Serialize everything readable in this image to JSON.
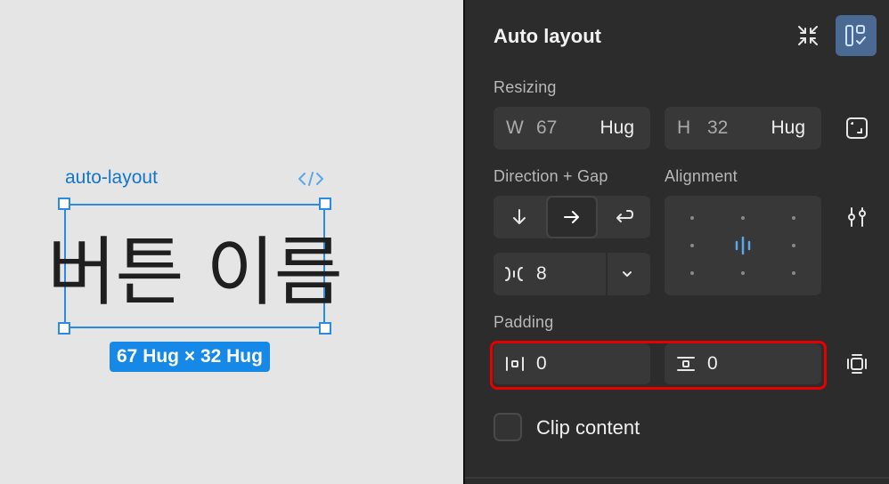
{
  "canvas": {
    "frame_label": "auto-layout",
    "frame_text": "버튼 이름",
    "size_badge": "67 Hug × 32 Hug"
  },
  "panel": {
    "title": "Auto layout",
    "resizing": {
      "label": "Resizing",
      "width": {
        "prefix": "W",
        "value": "67",
        "mode": "Hug"
      },
      "height": {
        "prefix": "H",
        "value": "32",
        "mode": "Hug"
      }
    },
    "direction": {
      "label": "Direction + Gap",
      "selected": "horizontal",
      "gap": "8"
    },
    "alignment": {
      "label": "Alignment",
      "selected": "center"
    },
    "padding": {
      "label": "Padding",
      "horizontal": "0",
      "vertical": "0"
    },
    "clip_content": {
      "label": "Clip content",
      "checked": false
    }
  },
  "colors": {
    "selection": "#2a8be6",
    "accent_active": "#4a6a93",
    "highlight": "#e60000"
  }
}
